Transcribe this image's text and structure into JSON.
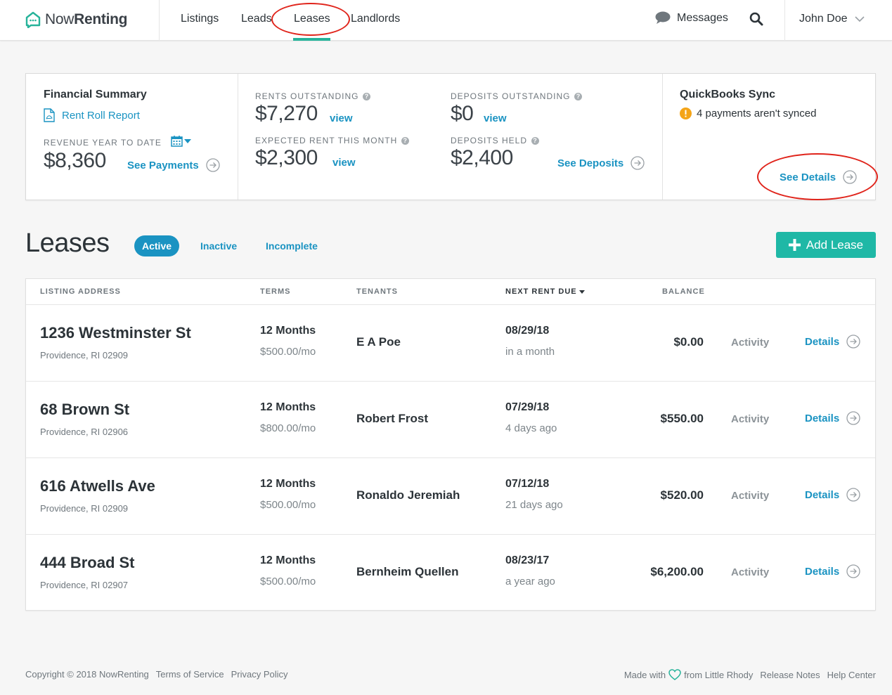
{
  "brand": {
    "name_light": "Now",
    "name_bold": "Renting"
  },
  "nav": {
    "listings": "Listings",
    "leads": "Leads",
    "leases": "Leases",
    "landlords": "Landlords"
  },
  "header": {
    "messages": "Messages",
    "user": "John Doe"
  },
  "summary": {
    "financial_title": "Financial Summary",
    "rent_roll": "Rent Roll Report",
    "revenue_label": "REVENUE YEAR TO DATE",
    "revenue_value": "$8,360",
    "see_payments": "See Payments",
    "rents_outstanding_label": "RENTS OUTSTANDING",
    "rents_outstanding_value": "$7,270",
    "expected_rent_label": "EXPECTED RENT THIS MONTH",
    "expected_rent_value": "$2,300",
    "deposits_outstanding_label": "DEPOSITS OUTSTANDING",
    "deposits_outstanding_value": "$0",
    "deposits_held_label": "DEPOSITS HELD",
    "deposits_held_value": "$2,400",
    "view": "view",
    "see_deposits": "See Deposits",
    "qb_title": "QuickBooks Sync",
    "qb_status": "4 payments aren't synced",
    "see_details": "See Details"
  },
  "leases": {
    "title": "Leases",
    "filters": [
      "Active",
      "Inactive",
      "Incomplete"
    ],
    "add_button": "Add Lease",
    "columns": [
      "LISTING ADDRESS",
      "TERMS",
      "TENANTS",
      "NEXT RENT DUE",
      "BALANCE"
    ],
    "activity_label": "Activity",
    "details_label": "Details",
    "rows": [
      {
        "address": "1236 Westminster St",
        "city": "Providence, RI 02909",
        "term": "12 Months",
        "rent": "$500.00/mo",
        "tenant": "E A Poe",
        "due": "08/29/18",
        "due_rel": "in a month",
        "balance": "$0.00"
      },
      {
        "address": "68 Brown St",
        "city": "Providence, RI 02906",
        "term": "12 Months",
        "rent": "$800.00/mo",
        "tenant": "Robert Frost",
        "due": "07/29/18",
        "due_rel": "4 days ago",
        "balance": "$550.00"
      },
      {
        "address": "616 Atwells Ave",
        "city": "Providence, RI 02909",
        "term": "12 Months",
        "rent": "$500.00/mo",
        "tenant": "Ronaldo Jeremiah",
        "due": "07/12/18",
        "due_rel": "21 days ago",
        "balance": "$520.00"
      },
      {
        "address": "444 Broad St",
        "city": "Providence, RI 02907",
        "term": "12 Months",
        "rent": "$500.00/mo",
        "tenant": "Bernheim Quellen",
        "due": "08/23/17",
        "due_rel": "a year ago",
        "balance": "$6,200.00"
      }
    ]
  },
  "footer": {
    "copyright": "Copyright © 2018 NowRenting",
    "terms": "Terms of Service",
    "privacy": "Privacy Policy",
    "made_with": "Made with",
    "from": "from Little Rhody",
    "release_notes": "Release Notes",
    "help_center": "Help Center"
  },
  "colors": {
    "accent": "#26b39a",
    "link": "#1a93c2",
    "warning": "#f4a417",
    "annotation": "#e0241b"
  },
  "icons": [
    "house-chat-logo-icon",
    "chat-bubble-icon",
    "search-icon",
    "chevron-down-icon",
    "pdf-icon",
    "calendar-icon",
    "help-icon",
    "circle-arrow-icon",
    "warning-icon",
    "plus-icon",
    "heart-icon"
  ]
}
